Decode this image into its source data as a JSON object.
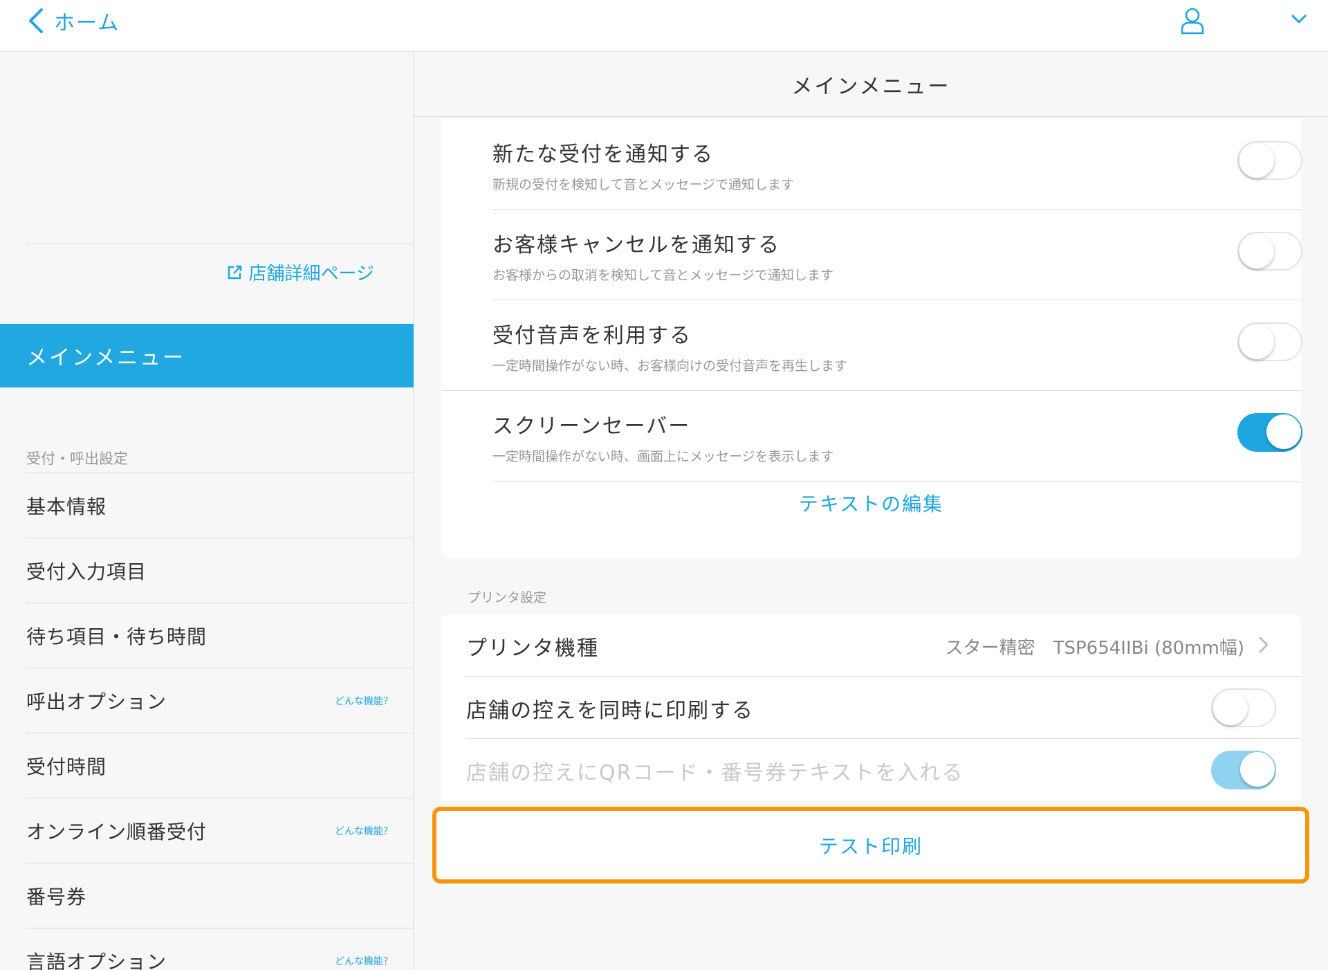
{
  "topbar": {
    "back_label": "ホーム"
  },
  "sidebar": {
    "store_link": "店舗詳細ページ",
    "active_item": "メインメニュー",
    "section_label": "受付・呼出設定",
    "help_label": "どんな機能？",
    "items": [
      {
        "label": "基本情報",
        "help": ""
      },
      {
        "label": "受付入力項目",
        "help": ""
      },
      {
        "label": "待ち項目・待ち時間",
        "help": ""
      },
      {
        "label": "呼出オプション",
        "help": "どんな機能？"
      },
      {
        "label": "受付時間",
        "help": ""
      },
      {
        "label": "オンライン順番受付",
        "help": "どんな機能？"
      },
      {
        "label": "番号券",
        "help": ""
      },
      {
        "label": "言語オプション",
        "help": "どんな機能？"
      }
    ]
  },
  "main": {
    "title": "メインメニュー",
    "settings": [
      {
        "title": "新たな受付を通知する",
        "subtitle": "新規の受付を検知して音とメッセージで通知します",
        "enabled": false
      },
      {
        "title": "お客様キャンセルを通知する",
        "subtitle": "お客様からの取消を検知して音とメッセージで通知します",
        "enabled": false
      },
      {
        "title": "受付音声を利用する",
        "subtitle": "一定時間操作がない時、お客様向けの受付音声を再生します",
        "enabled": false
      },
      {
        "title": "スクリーンセーバー",
        "subtitle": "一定時間操作がない時、画面上にメッセージを表示します",
        "enabled": true
      }
    ],
    "text_edit_label": "テキストの編集",
    "printer_section_label": "プリンタ設定",
    "printer": {
      "model_label": "プリンタ機種",
      "model_value": "スター精密　TSP654IIBi (80mm幅)",
      "store_copy_label": "店舗の控えを同時に印刷する",
      "store_copy_enabled": false,
      "qr_label": "店舗の控えにQRコード・番号券テキストを入れる",
      "qr_enabled": true,
      "qr_disabled": true
    },
    "test_print_label": "テスト印刷"
  },
  "colors": {
    "accent": "#1da6e0",
    "active_bg": "#21a8e1",
    "highlight": "#f7960d"
  }
}
